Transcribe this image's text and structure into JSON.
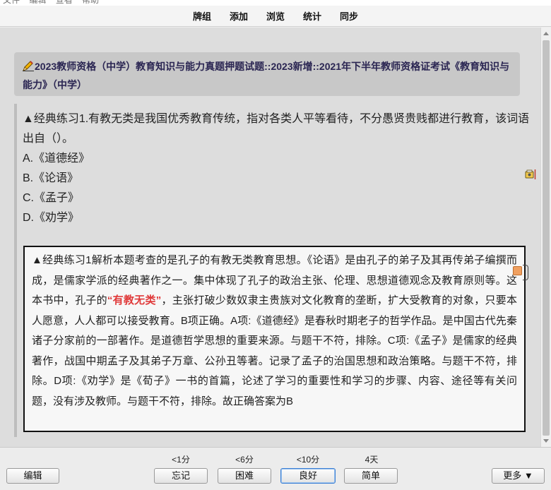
{
  "os_menu": [
    "文件",
    "编辑",
    "查看",
    "帮助"
  ],
  "toolbar": {
    "decks": "牌组",
    "add": "添加",
    "browse": "浏览",
    "stats": "统计",
    "sync": "同步"
  },
  "card": {
    "deck_path": "2023教师资格（中学）教育知识与能力真题押题试题::2023新增::2021年下半年教师资格证考试《教育知识与能力》（中学）",
    "question": "▲经典练习1.有教无类是我国优秀教育传统，指对各类人平等看待，不分愚贤贵贱都进行教育，该词语出自（）。",
    "options": [
      "A.《道德经》",
      "B.《论语》",
      "C.《孟子》",
      "D.《劝学》"
    ],
    "answer_part1": "▲经典练习1解析本题考查的是孔子的有教无类教育思想。《论语》是由孔子的弟子及其再传弟子编撰而成，是儒家学派的经典著作之一。集中体现了孔子的政治主张、伦理、思想道德观念及教育原则等。这本书中，孔子的",
    "answer_highlight": "“有教无类”",
    "answer_part2": "，主张打破少数奴隶主贵族对文化教育的垄断，扩大受教育的对象，只要本人愿意，人人都可以接受教育。B项正确。A项:《道德经》是春秋时期老子的哲学作品。是中国古代先秦诸子分家前的一部著作。是道德哲学思想的重要来源。与题干不符，排除。C项:《孟子》是儒家的经典著作，战国中期孟子及其弟子万章、公孙丑等著。记录了孟子的治国思想和政治策略。与题干不符，排除。D项:《劝学》是《荀子》一书的首篇，论述了学习的重要性和学习的步骤、内容、途径等有关问题，没有涉及教师。与题干不符，排除。故正确答案为B",
    "highlight_color": "#e03a3a"
  },
  "bottom": {
    "edit": "编辑",
    "more": "更多 ▼",
    "answers": [
      {
        "interval": "<1分",
        "label": "忘记"
      },
      {
        "interval": "<6分",
        "label": "困难"
      },
      {
        "interval": "<10分",
        "label": "良好"
      },
      {
        "interval": "4天",
        "label": "简单"
      }
    ]
  },
  "icons": {
    "deck_title": "pencil-icon",
    "side": "flag-icon"
  }
}
